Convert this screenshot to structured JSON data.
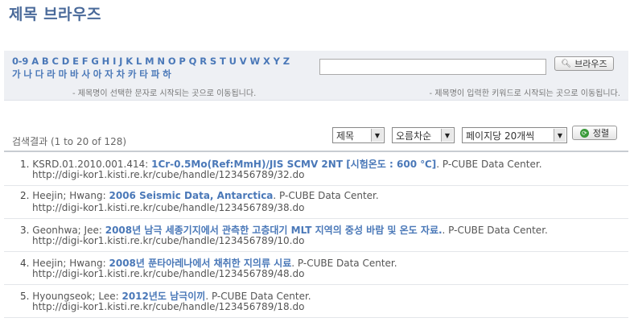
{
  "page": {
    "title": "제목 브라우즈"
  },
  "browse": {
    "letters_row1": [
      "0-9",
      "A",
      "B",
      "C",
      "D",
      "E",
      "F",
      "G",
      "H",
      "I",
      "J",
      "K",
      "L",
      "M",
      "N",
      "O",
      "P",
      "Q",
      "R",
      "S",
      "T",
      "U",
      "V",
      "W",
      "X",
      "Y",
      "Z"
    ],
    "letters_row2": [
      "가",
      "나",
      "다",
      "라",
      "마",
      "바",
      "사",
      "아",
      "자",
      "차",
      "카",
      "타",
      "파",
      "하"
    ],
    "hint_left": "- 제목명이 선택한 문자로 시작되는 곳으로 이동됩니다.",
    "hint_right": "- 제목명이 입력한 키워드로 시작되는 곳으로 이동됩니다.",
    "search_value": "",
    "browse_button_label": "브라우즈",
    "browse_button_icon": "search-icon"
  },
  "controls": {
    "results_count": "검색결과 (1 to 20 of 128)",
    "sort_field": "제목",
    "sort_order": "오름차순",
    "per_page": "페이지당 20개씩",
    "sort_button_label": "정렬",
    "sort_button_icon": "go-icon",
    "accent_color": "#4a78b8"
  },
  "results": [
    {
      "num": "1.",
      "prefix": "KSRD.01.2010.001.414:",
      "title": "1Cr-0.5Mo(Ref:MmH)/JIS SCMV 2NT [시험온도 : 600 ℃]",
      "suffix": ". P-CUBE Data Center.",
      "url": "http://digi-kor1.kisti.re.kr/cube/handle/123456789/32.do"
    },
    {
      "num": "2.",
      "prefix": "Heejin; Hwang:",
      "title": "2006 Seismic Data, Antarctica",
      "suffix": ". P-CUBE Data Center.",
      "url": "http://digi-kor1.kisti.re.kr/cube/handle/123456789/38.do"
    },
    {
      "num": "3.",
      "prefix": "Geonhwa; Jee:",
      "title": "2008년 남극 세종기지에서 관측한 고층대기 MLT 지역의 중성 바람 및 온도 자료.",
      "suffix": ". P-CUBE Data Center.",
      "url": "http://digi-kor1.kisti.re.kr/cube/handle/123456789/10.do"
    },
    {
      "num": "4.",
      "prefix": "Heejin; Hwang:",
      "title": "2008년 푼타아레나에서 채취한 지의류 시료",
      "suffix": ". P-CUBE Data Center.",
      "url": "http://digi-kor1.kisti.re.kr/cube/handle/123456789/48.do"
    },
    {
      "num": "5.",
      "prefix": "Hyoungseok; Lee:",
      "title": "2012년도 남극이끼",
      "suffix": ". P-CUBE Data Center.",
      "url": "http://digi-kor1.kisti.re.kr/cube/handle/123456789/18.do"
    }
  ]
}
